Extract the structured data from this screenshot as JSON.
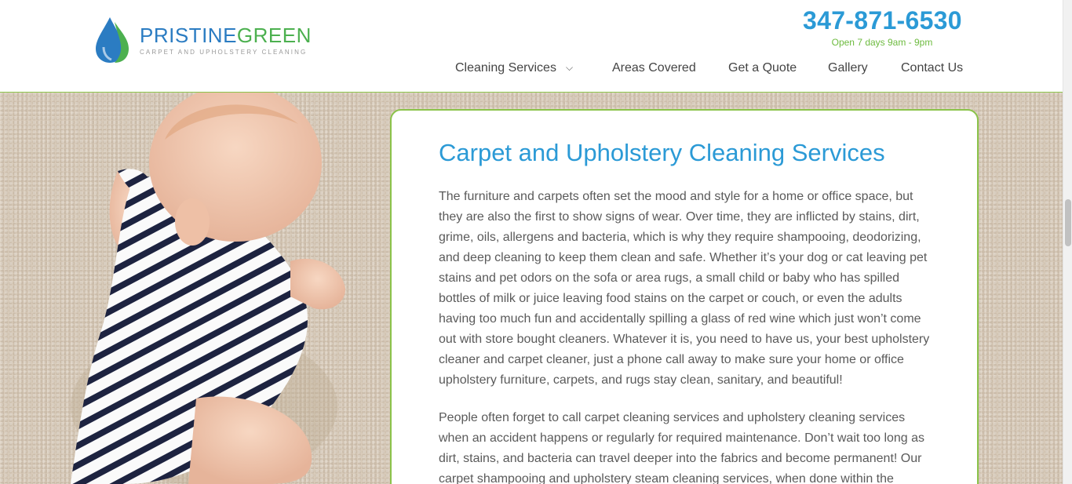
{
  "brand": {
    "name_part1": "PRISTINE",
    "name_part2": "GREEN",
    "tagline": "CARPET AND UPHOLSTERY CLEANING",
    "colors": {
      "blue": "#2b7cc2",
      "green": "#4cb04f",
      "accent": "#2b9ad6"
    }
  },
  "header": {
    "phone": "347-871-6530",
    "hours": "Open 7 days 9am - 9pm"
  },
  "nav": {
    "items": [
      {
        "label": "Cleaning Services",
        "icon": "chevron-down-icon"
      },
      {
        "label": "Areas Covered"
      },
      {
        "label": "Get a Quote"
      },
      {
        "label": "Gallery"
      },
      {
        "label": "Contact Us"
      }
    ]
  },
  "content": {
    "title": "Carpet and Upholstery Cleaning Services",
    "paragraph1": "The furniture and carpets often set the mood and style for a home or office space, but they are also the first to show signs of wear. Over time, they are inflicted by stains, dirt, grime, oils, allergens and bacteria, which is why they require shampooing, deodorizing, and deep cleaning to keep them clean and safe. Whether it’s your dog or cat leaving pet stains and pet odors on the sofa or area rugs, a small child or baby who has spilled bottles of milk or juice leaving food stains on the carpet or couch, or even the adults having too much fun and accidentally spilling a glass of red wine which just won’t come out with store bought cleaners. Whatever it is, you need to have us, your best upholstery cleaner and carpet cleaner, just a phone call away to make sure your home or office upholstery furniture, carpets, and rugs stay clean, sanitary, and beautiful!",
    "paragraph2": "People often forget to call carpet cleaning services and upholstery cleaning services when an accident happens or regularly for required maintenance. Don’t wait too long as dirt, stains, and bacteria can travel deeper into the fabrics and become permanent! Our carpet shampooing and upholstery steam cleaning services, when done within the"
  }
}
